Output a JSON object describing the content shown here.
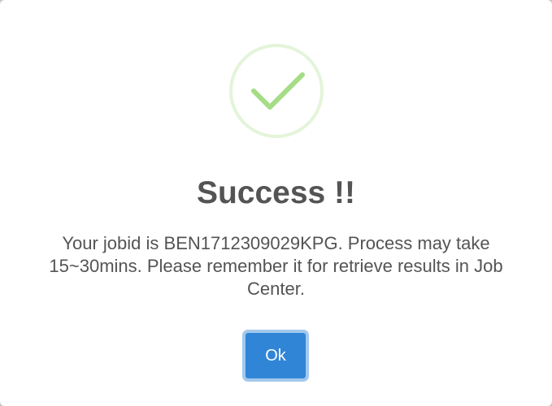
{
  "dialog": {
    "icon": "success-check-icon",
    "title": "Success !!",
    "message": "Your jobid is BEN1712309029KPG. Process may take 15~30mins. Please remember it for retrieve results in Job Center.",
    "ok_label": "Ok"
  },
  "colors": {
    "check": "#a5dc86",
    "ring": "rgba(165,220,134,0.3)",
    "button": "#3085d6",
    "text": "#545454"
  }
}
